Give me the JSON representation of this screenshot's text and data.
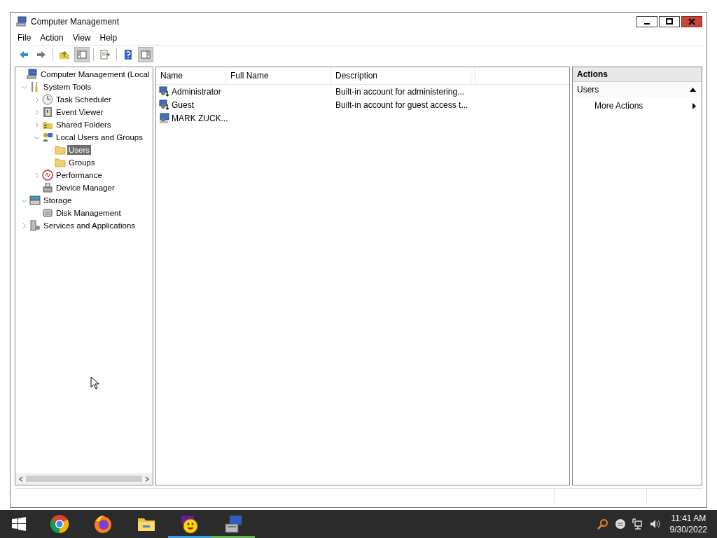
{
  "window": {
    "title": "Computer Management"
  },
  "menu": [
    "File",
    "Action",
    "View",
    "Help"
  ],
  "toolbar": [
    {
      "kind": "back",
      "disabled": false
    },
    {
      "kind": "forward",
      "disabled": false
    },
    {
      "kind": "sep"
    },
    {
      "kind": "up",
      "disabled": false
    },
    {
      "kind": "tree",
      "selected": true
    },
    {
      "kind": "sep"
    },
    {
      "kind": "export",
      "disabled": false
    },
    {
      "kind": "sep"
    },
    {
      "kind": "help",
      "disabled": false
    },
    {
      "kind": "actionpane",
      "selected": true
    }
  ],
  "tree": [
    {
      "label": "Computer Management (Local",
      "kind": "computer",
      "selected": false,
      "children": [
        {
          "label": "System Tools",
          "kind": "tools",
          "expanded": true,
          "selected": false,
          "children": [
            {
              "label": "Task Scheduler",
              "kind": "clock",
              "expanded": false,
              "selected": false
            },
            {
              "label": "Event Viewer",
              "kind": "log",
              "expanded": false,
              "selected": false
            },
            {
              "label": "Shared Folders",
              "kind": "share",
              "expanded": false,
              "selected": false
            },
            {
              "label": "Local Users and Groups",
              "kind": "users",
              "expanded": true,
              "selected": false,
              "children": [
                {
                  "label": "Users",
                  "kind": "folder",
                  "selected": true
                },
                {
                  "label": "Groups",
                  "kind": "folder",
                  "selected": false
                }
              ]
            },
            {
              "label": "Performance",
              "kind": "perf",
              "expanded": false,
              "selected": false
            },
            {
              "label": "Device Manager",
              "kind": "device",
              "selected": false
            }
          ]
        },
        {
          "label": "Storage",
          "kind": "storage",
          "expanded": true,
          "selected": false,
          "children": [
            {
              "label": "Disk Management",
              "kind": "disk",
              "selected": false
            }
          ]
        },
        {
          "label": "Services and Applications",
          "kind": "services",
          "expanded": false,
          "selected": false
        }
      ]
    }
  ],
  "table": {
    "columns": [
      "Name",
      "Full Name",
      "Description"
    ],
    "rows": [
      {
        "name": "Administrator",
        "full_name": "",
        "description": "Built-in account for administering...",
        "kind": "builtin"
      },
      {
        "name": "Guest",
        "full_name": "",
        "description": "Built-in account for guest access t...",
        "kind": "builtin"
      },
      {
        "name": "MARK ZUCK...",
        "full_name": "",
        "description": "",
        "kind": "user"
      }
    ]
  },
  "actions": {
    "title": "Actions",
    "sections": [
      {
        "label": "Users",
        "expanded": true,
        "items": [
          "More Actions"
        ]
      }
    ]
  },
  "taskbar": {
    "apps": [
      {
        "kind": "chrome"
      },
      {
        "kind": "firefox"
      },
      {
        "kind": "explorer"
      },
      {
        "kind": "yahoo",
        "color": "#3a9fe8"
      },
      {
        "kind": "compmgmt",
        "color": "#5fb84a"
      }
    ],
    "time": "11:41 AM",
    "date": "9/30/2022"
  }
}
